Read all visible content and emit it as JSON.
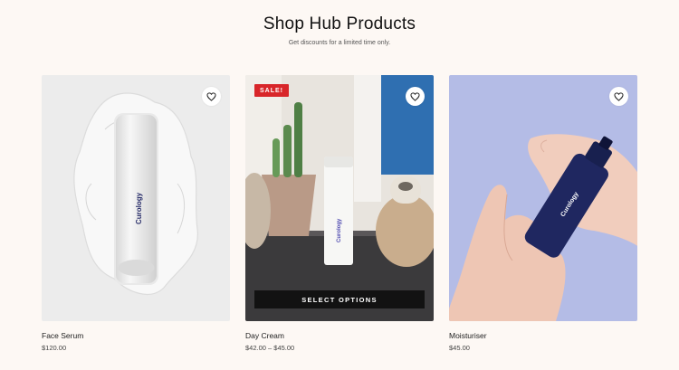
{
  "header": {
    "title": "Shop Hub Products",
    "subtitle": "Get discounts for a limited time only."
  },
  "products": [
    {
      "name": "Face Serum",
      "price": "$120.00",
      "brand_text": "Curology",
      "wishlist_icon": "heart-outline-icon"
    },
    {
      "name": "Day Cream",
      "price": "$42.00 – $45.00",
      "badge": "SALE!",
      "button": "SELECT OPTIONS",
      "brand_text": "Curology",
      "wishlist_icon": "heart-outline-icon"
    },
    {
      "name": "Moisturiser",
      "price": "$45.00",
      "brand_text": "Curology",
      "wishlist_icon": "heart-outline-icon"
    }
  ],
  "colors": {
    "background": "#fdf8f4",
    "sale_badge": "#d8262a",
    "button": "#121212",
    "card2_wall": "#2f6fb1",
    "card3_background": "#b4bce6",
    "bottle_navy": "#1f2760"
  }
}
